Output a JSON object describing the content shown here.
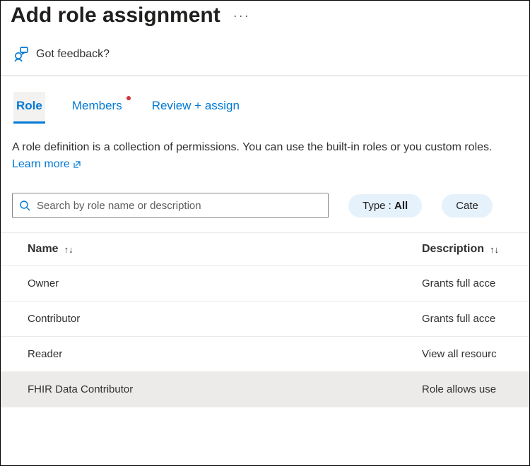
{
  "header": {
    "title": "Add role assignment",
    "ellipsis": "···"
  },
  "feedback": {
    "label": "Got feedback?"
  },
  "tabs": [
    {
      "label": "Role",
      "active": true,
      "dot": false
    },
    {
      "label": "Members",
      "active": false,
      "dot": true
    },
    {
      "label": "Review + assign",
      "active": false,
      "dot": false
    }
  ],
  "description": {
    "text": "A role definition is a collection of permissions. You can use the built-in roles or you custom roles. ",
    "learn_more": "Learn more"
  },
  "search": {
    "placeholder": "Search by role name or description"
  },
  "filters": {
    "type_prefix": "Type : ",
    "type_value": "All",
    "category_prefix": "Cate"
  },
  "table": {
    "columns": {
      "name": "Name",
      "description": "Description"
    },
    "rows": [
      {
        "name": "Owner",
        "description": "Grants full acce",
        "selected": false
      },
      {
        "name": "Contributor",
        "description": "Grants full acce",
        "selected": false
      },
      {
        "name": "Reader",
        "description": "View all resourc",
        "selected": false
      },
      {
        "name": "FHIR Data Contributor",
        "description": "Role allows use",
        "selected": true
      }
    ]
  }
}
